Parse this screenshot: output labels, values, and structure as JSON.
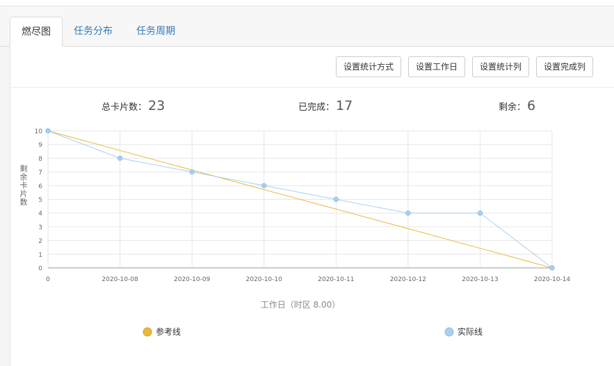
{
  "tabs": [
    {
      "label": "燃尽图",
      "active": true
    },
    {
      "label": "任务分布",
      "active": false
    },
    {
      "label": "任务周期",
      "active": false
    }
  ],
  "toolbar": {
    "buttons": [
      "设置统计方式",
      "设置工作日",
      "设置统计列",
      "设置完成列"
    ]
  },
  "stats": {
    "total_label": "总卡片数：",
    "total_value": "23",
    "done_label": "已完成：",
    "done_value": "17",
    "remaining_label": "剩余：",
    "remaining_value": "6"
  },
  "colors": {
    "reference_line": "#e8b93a",
    "actual_line": "#a8d0f0",
    "tab_link": "#337ab7"
  },
  "chart_data": {
    "type": "line",
    "categories": [
      "0",
      "2020-10-08",
      "2020-10-09",
      "2020-10-10",
      "2020-10-11",
      "2020-10-12",
      "2020-10-13",
      "2020-10-14"
    ],
    "series": [
      {
        "name": "参考线",
        "values": [
          10,
          8.57,
          7.14,
          5.71,
          4.29,
          2.86,
          1.43,
          0
        ],
        "markers": false
      },
      {
        "name": "实际线",
        "values": [
          10,
          8,
          7,
          6,
          5,
          4,
          4,
          0
        ],
        "markers": true
      }
    ],
    "xlabel": "工作日（时区 8.00）",
    "ylabel": "剩余卡片数",
    "ylim": [
      0,
      10
    ],
    "yticks": [
      0,
      1,
      2,
      3,
      4,
      5,
      6,
      7,
      8,
      9,
      10
    ],
    "grid": true,
    "legend": "bottom"
  }
}
